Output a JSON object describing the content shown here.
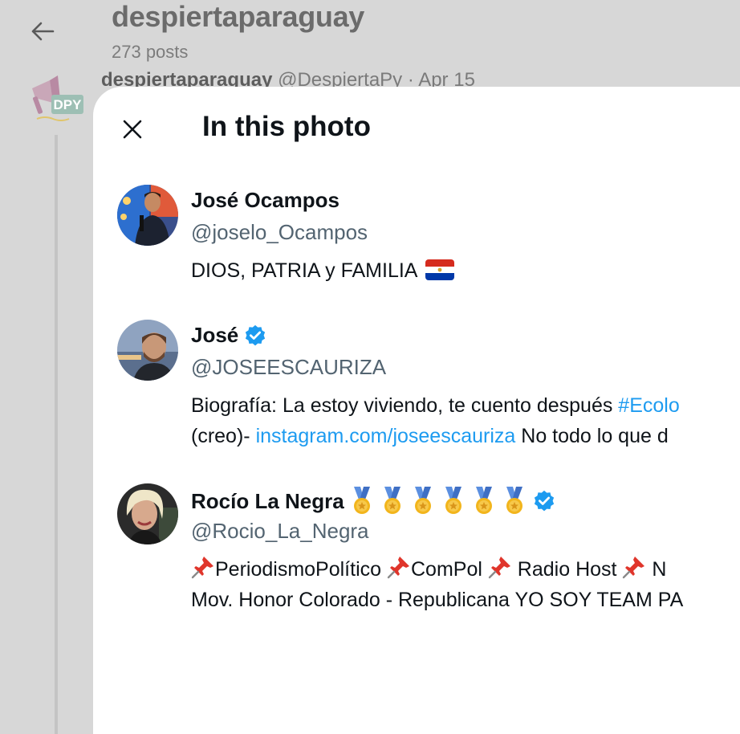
{
  "background": {
    "title": "despiertaparaguay",
    "post_count": "273 posts",
    "tweet": {
      "name": "despiertaparaguay",
      "handle": "@DespiertaPy",
      "separator": "·",
      "date": "Apr 15"
    },
    "avatar_text": "DPY"
  },
  "modal": {
    "title": "In this photo",
    "close_icon": "close-icon",
    "people": [
      {
        "name": "José Ocampos",
        "handle": "@joselo_Ocampos",
        "bio": "DIOS, PATRIA y FAMILIA",
        "bio_emoji": "paraguay-flag"
      },
      {
        "name": "José",
        "verified": true,
        "handle": "@JOSEESCAURIZA",
        "bio_line1_text": "Biografía: La estoy viviendo, te cuento después ",
        "bio_line1_link": "#Ecolo",
        "bio_line2_prefix": "(creo)- ",
        "bio_line2_link": "instagram.com/joseescauriza",
        "bio_line2_suffix": " No todo lo que d"
      },
      {
        "name": "Rocío La Negra",
        "medal_count": 6,
        "verified": true,
        "handle": "@Rocio_La_Negra",
        "bio_line1_items": [
          "PeriodismoPolítico",
          "ComPol",
          " Radio Host",
          " N"
        ],
        "bio_line2": "Mov. Honor Colorado - Republicana YO SOY TEAM PA"
      }
    ]
  },
  "colors": {
    "link": "#1d9bf0",
    "verified": "#1d9bf0",
    "secondary_text": "#536471",
    "backdrop": "#d7d7d7"
  }
}
